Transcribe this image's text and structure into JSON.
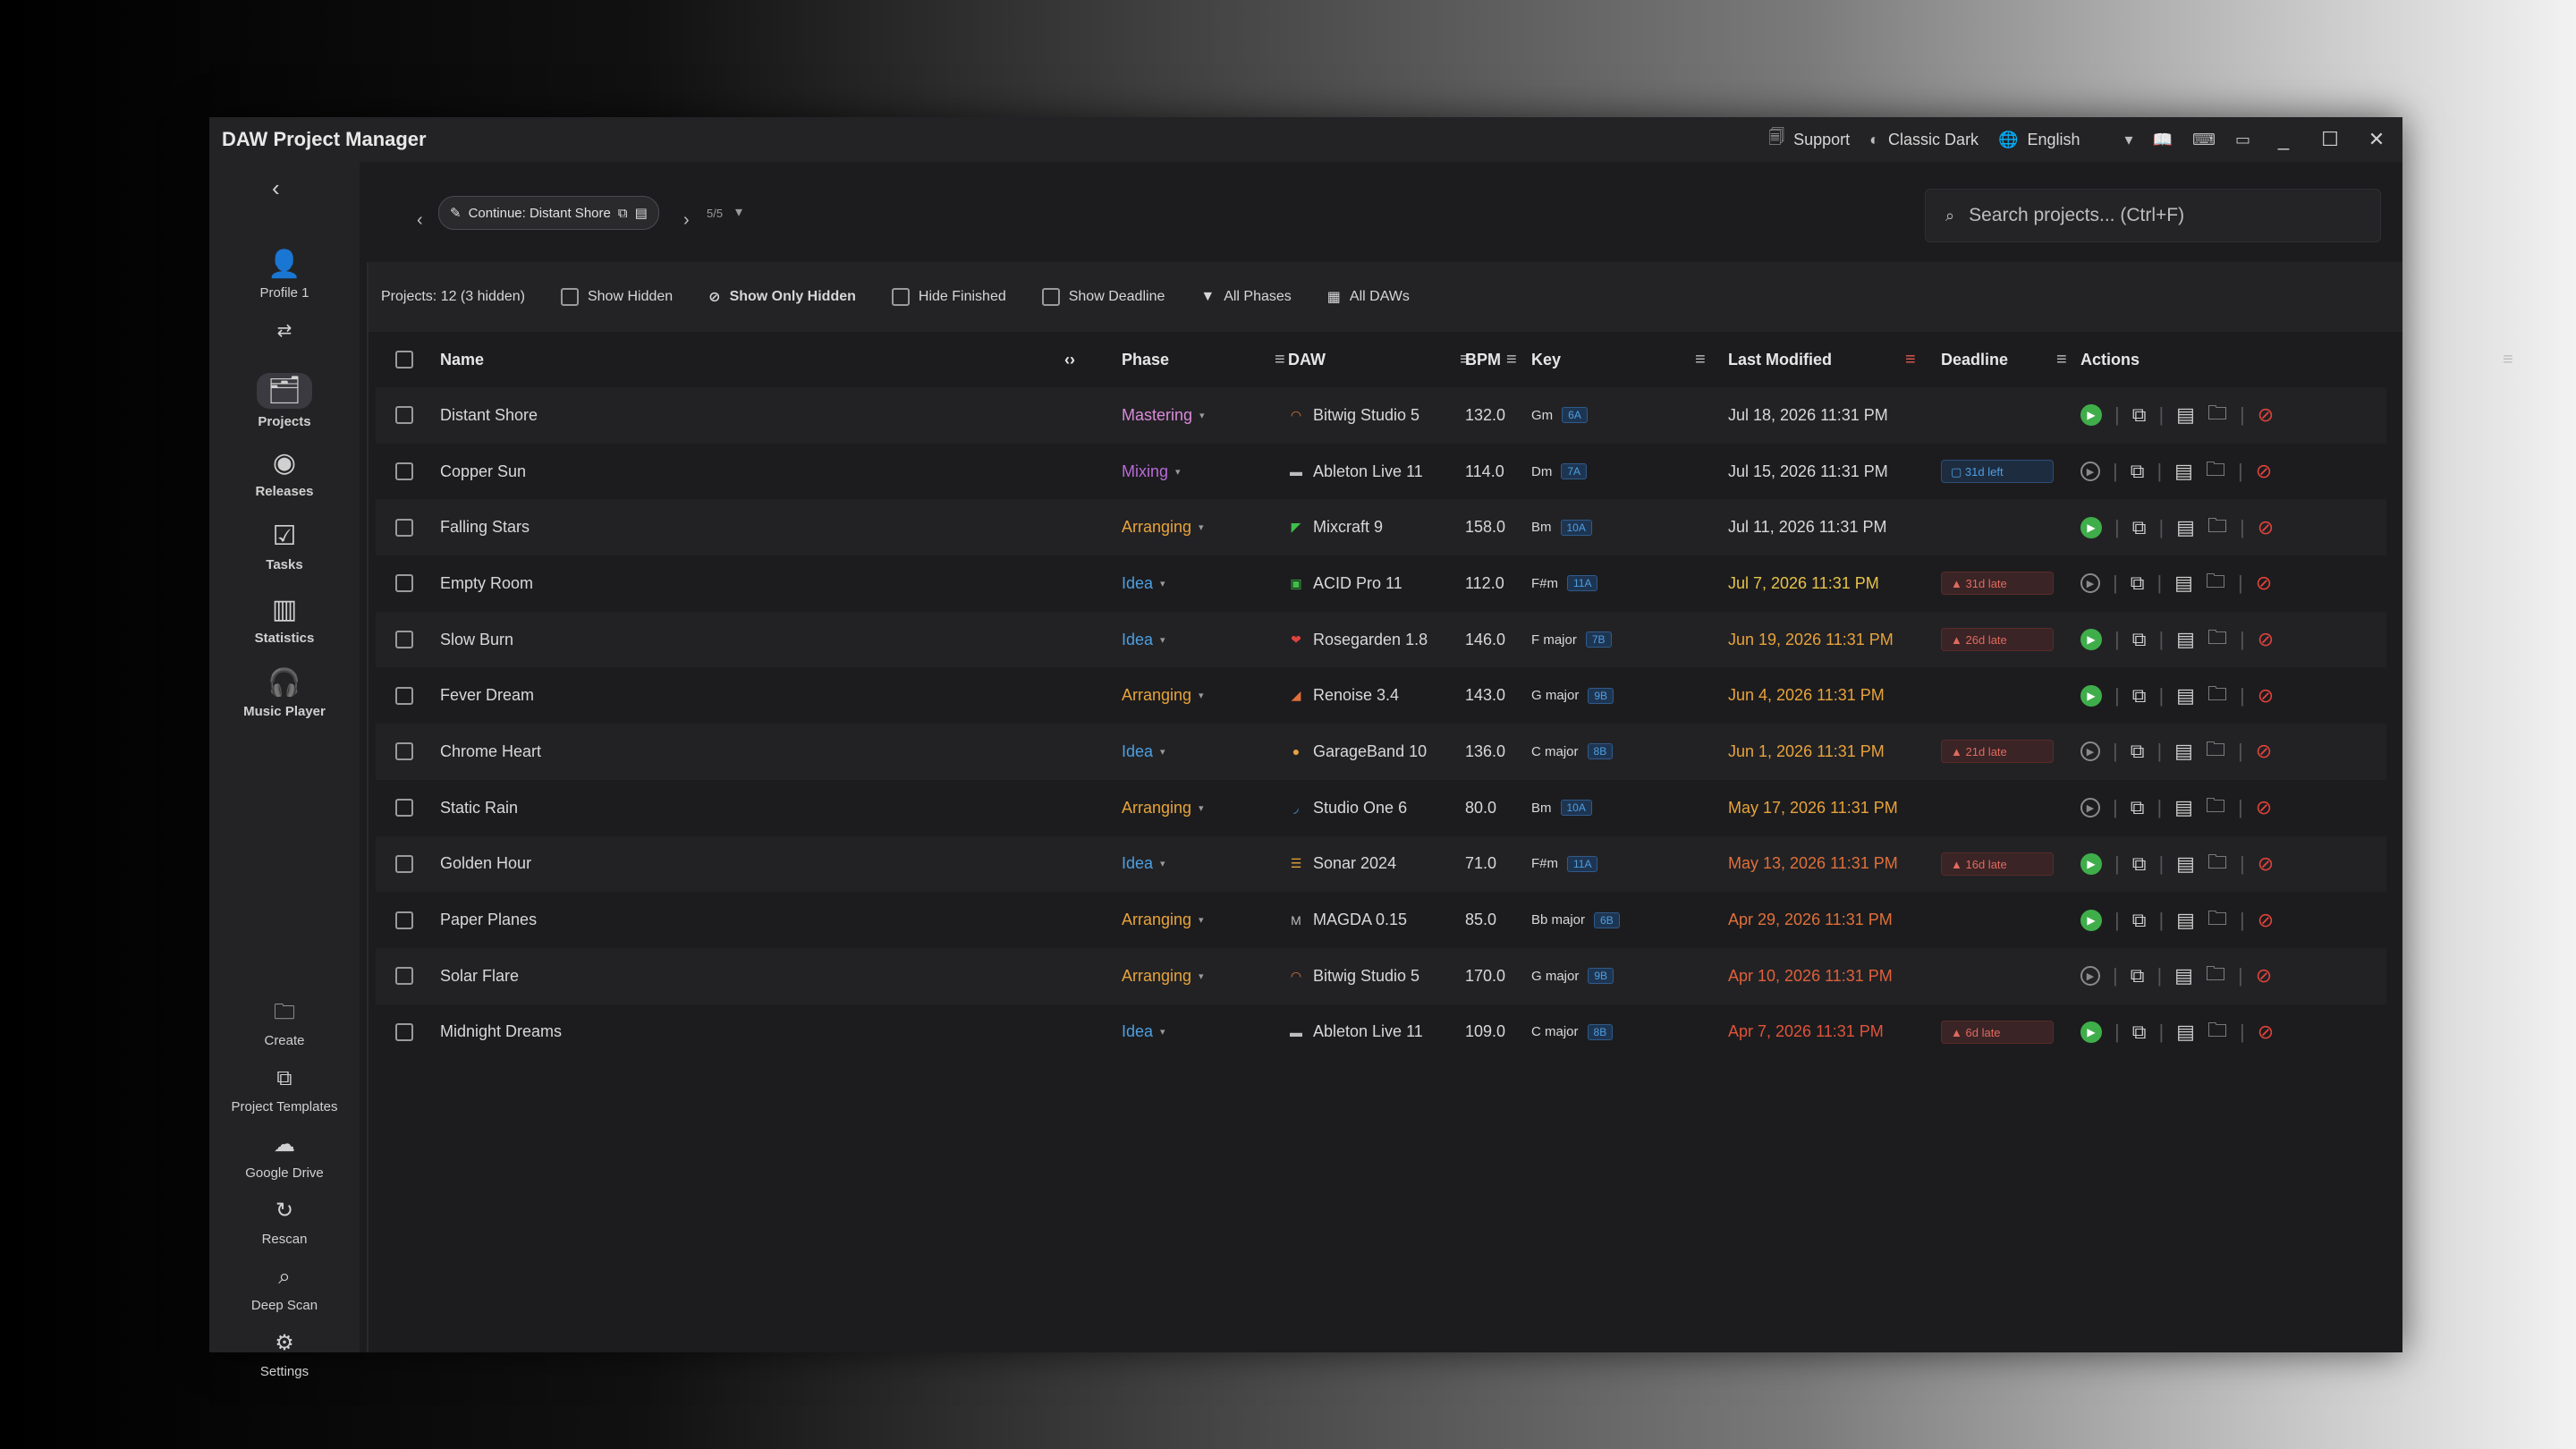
{
  "window": {
    "title": "DAW Project Manager"
  },
  "titlebar": {
    "support": "Support",
    "theme": "Classic Dark",
    "language": "English"
  },
  "sidebar": {
    "profile": "Profile 1",
    "items": [
      {
        "label": "Projects",
        "icon": "projects-icon"
      },
      {
        "label": "Releases",
        "icon": "disc-icon"
      },
      {
        "label": "Tasks",
        "icon": "tasks-icon"
      },
      {
        "label": "Statistics",
        "icon": "bar-chart-icon"
      },
      {
        "label": "Music Player",
        "icon": "headphones-icon"
      }
    ],
    "bottom_items": [
      {
        "label": "Create",
        "icon": "create-folder-icon"
      },
      {
        "label": "Project Templates",
        "icon": "templates-icon"
      },
      {
        "label": "Google Drive",
        "icon": "cloud-icon"
      },
      {
        "label": "Rescan",
        "icon": "refresh-icon"
      },
      {
        "label": "Deep Scan",
        "icon": "search-icon"
      },
      {
        "label": "Settings",
        "icon": "gear-icon"
      }
    ]
  },
  "toolbar": {
    "continue_label": "Continue: Distant Shore",
    "pager": "5/5",
    "search_placeholder": "Search projects... (Ctrl+F)"
  },
  "filters": {
    "count": "Projects: 12 (3 hidden)",
    "show_hidden": "Show Hidden",
    "show_only_hidden": "Show Only Hidden",
    "hide_finished": "Hide Finished",
    "show_deadline": "Show Deadline",
    "all_phases": "All Phases",
    "all_daws": "All DAWs"
  },
  "table": {
    "headers": {
      "name": "Name",
      "phase": "Phase",
      "daw": "DAW",
      "bpm": "BPM",
      "key": "Key",
      "last_modified": "Last Modified",
      "deadline": "Deadline",
      "actions": "Actions"
    },
    "rows": [
      {
        "name": "Distant Shore",
        "phase": "Mastering",
        "phase_color": "#d98ad8",
        "daw": "Bitwig Studio 5",
        "daw_icon": "◠",
        "daw_color": "#e07a3a",
        "bpm": "132.0",
        "key": "Gm",
        "camelot": "6A",
        "modified": "Jul 18, 2026 11:31 PM",
        "mod_color": "#d8d8d8",
        "deadline": "",
        "deadline_type": "",
        "playing": true
      },
      {
        "name": "Copper Sun",
        "phase": "Mixing",
        "phase_color": "#b86ad8",
        "daw": "Ableton Live 11",
        "daw_icon": "▬",
        "daw_color": "#bdbdbd",
        "bpm": "114.0",
        "key": "Dm",
        "camelot": "7A",
        "modified": "Jul 15, 2026 11:31 PM",
        "mod_color": "#d8d8d8",
        "deadline": "31d left",
        "deadline_type": "left",
        "playing": false
      },
      {
        "name": "Falling Stars",
        "phase": "Arranging",
        "phase_color": "#e8a33a",
        "daw": "Mixcraft 9",
        "daw_icon": "◤",
        "daw_color": "#3fbf4a",
        "bpm": "158.0",
        "key": "Bm",
        "camelot": "10A",
        "modified": "Jul 11, 2026 11:31 PM",
        "mod_color": "#d8d8d8",
        "deadline": "",
        "deadline_type": "",
        "playing": true
      },
      {
        "name": "Empty Room",
        "phase": "Idea",
        "phase_color": "#4d9fe0",
        "daw": "ACID Pro 11",
        "daw_icon": "▣",
        "daw_color": "#3fbf4a",
        "bpm": "112.0",
        "key": "F#m",
        "camelot": "11A",
        "modified": "Jul 7, 2026 11:31 PM",
        "mod_color": "#e6c34a",
        "deadline": "31d late",
        "deadline_type": "late",
        "playing": false
      },
      {
        "name": "Slow Burn",
        "phase": "Idea",
        "phase_color": "#4d9fe0",
        "daw": "Rosegarden 1.8",
        "daw_icon": "❤",
        "daw_color": "#e0433c",
        "bpm": "146.0",
        "key": "F major",
        "camelot": "7B",
        "modified": "Jun 19, 2026 11:31 PM",
        "mod_color": "#e8a33a",
        "deadline": "26d late",
        "deadline_type": "late",
        "playing": true
      },
      {
        "name": "Fever Dream",
        "phase": "Arranging",
        "phase_color": "#e8a33a",
        "daw": "Renoise 3.4",
        "daw_icon": "◢",
        "daw_color": "#e0703a",
        "bpm": "143.0",
        "key": "G major",
        "camelot": "9B",
        "modified": "Jun 4, 2026 11:31 PM",
        "mod_color": "#e8a33a",
        "deadline": "",
        "deadline_type": "",
        "playing": true
      },
      {
        "name": "Chrome Heart",
        "phase": "Idea",
        "phase_color": "#4d9fe0",
        "daw": "GarageBand 10",
        "daw_icon": "●",
        "daw_color": "#e8a33a",
        "bpm": "136.0",
        "key": "C major",
        "camelot": "8B",
        "modified": "Jun 1, 2026 11:31 PM",
        "mod_color": "#e8a33a",
        "deadline": "21d late",
        "deadline_type": "late",
        "playing": false
      },
      {
        "name": "Static Rain",
        "phase": "Arranging",
        "phase_color": "#e8a33a",
        "daw": "Studio One 6",
        "daw_icon": "◞",
        "daw_color": "#4d9fe0",
        "bpm": "80.0",
        "key": "Bm",
        "camelot": "10A",
        "modified": "May 17, 2026 11:31 PM",
        "mod_color": "#e8a33a",
        "deadline": "",
        "deadline_type": "",
        "playing": false
      },
      {
        "name": "Golden Hour",
        "phase": "Idea",
        "phase_color": "#4d9fe0",
        "daw": "Sonar 2024",
        "daw_icon": "☰",
        "daw_color": "#e8a33a",
        "bpm": "71.0",
        "key": "F#m",
        "camelot": "11A",
        "modified": "May 13, 2026 11:31 PM",
        "mod_color": "#e0703a",
        "deadline": "16d late",
        "deadline_type": "late",
        "playing": true
      },
      {
        "name": "Paper Planes",
        "phase": "Arranging",
        "phase_color": "#e8a33a",
        "daw": "MAGDA 0.15",
        "daw_icon": "M",
        "daw_color": "#bdbdbd",
        "bpm": "85.0",
        "key": "Bb major",
        "camelot": "6B",
        "modified": "Apr 29, 2026 11:31 PM",
        "mod_color": "#e0703a",
        "deadline": "",
        "deadline_type": "",
        "playing": true
      },
      {
        "name": "Solar Flare",
        "phase": "Arranging",
        "phase_color": "#e8a33a",
        "daw": "Bitwig Studio 5",
        "daw_icon": "◠",
        "daw_color": "#e07a3a",
        "bpm": "170.0",
        "key": "G major",
        "camelot": "9B",
        "modified": "Apr 10, 2026 11:31 PM",
        "mod_color": "#e0603a",
        "deadline": "",
        "deadline_type": "",
        "playing": false
      },
      {
        "name": "Midnight Dreams",
        "phase": "Idea",
        "phase_color": "#4d9fe0",
        "daw": "Ableton Live 11",
        "daw_icon": "▬",
        "daw_color": "#bdbdbd",
        "bpm": "109.0",
        "key": "C major",
        "camelot": "8B",
        "modified": "Apr 7, 2026 11:31 PM",
        "mod_color": "#e0533a",
        "deadline": "6d late",
        "deadline_type": "late",
        "playing": true
      }
    ]
  }
}
